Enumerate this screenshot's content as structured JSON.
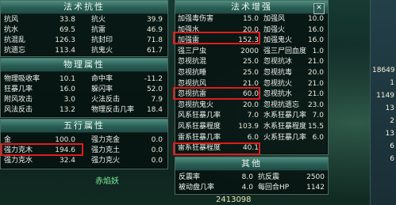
{
  "resist": {
    "title": "法术抗性",
    "rows": [
      {
        "l1": "抗风",
        "v1": "33.8",
        "l2": "抗火",
        "v2": "39.9"
      },
      {
        "l1": "抗水",
        "v1": "69.5",
        "l2": "抗雷",
        "v2": "46.9"
      },
      {
        "l1": "抗混乱",
        "v1": "126.3",
        "l2": "抗封印",
        "v2": "71.8"
      },
      {
        "l1": "抗遗忘",
        "v1": "113.4",
        "l2": "抗鬼火",
        "v2": "61.7"
      }
    ]
  },
  "physical": {
    "title": "物理属性",
    "rows": [
      {
        "l1": "物理吸收率",
        "v1": "10.1",
        "l2": "命中率",
        "v2": "-11.2"
      },
      {
        "l1": "狂暴几率",
        "v1": "16.0",
        "l2": "躲闪率",
        "v2": "52.0"
      },
      {
        "l1": "附风攻击",
        "v1": "3.0",
        "l2": "火法反击",
        "v2": "7.9"
      },
      {
        "l1": "风法反击",
        "v1": "13.2",
        "l2": "物理反击几率",
        "v2": "18.4"
      }
    ]
  },
  "five": {
    "title": "五行属性",
    "rows": [
      {
        "l1": "金",
        "v1": "100.0",
        "l2": "强力克金",
        "v2": "0.0"
      },
      {
        "l1": "强力克木",
        "v1": "194.6",
        "l2": "强力克土",
        "v2": "0.0"
      },
      {
        "l1": "强力克水",
        "v1": "32.4",
        "l2": "强力克火",
        "v2": "0.0"
      }
    ],
    "watermark": "赤焰妖"
  },
  "boost": {
    "title": "法术增强",
    "rows": [
      {
        "l1": "加强毒伤害",
        "v1": "15.0",
        "l2": "加强风",
        "v2": "10.0"
      },
      {
        "l1": "加强水",
        "v1": "20.0",
        "l2": "加强火",
        "v2": "16.0"
      },
      {
        "l1": "加强雷",
        "v1": "152.3",
        "l2": "加强鬼火",
        "v2": "16.0"
      },
      {
        "l1": "强三尸虫",
        "v1": "2000",
        "l2": "强三尸回血度",
        "v2": "1.0"
      },
      {
        "l1": "忽视抗混",
        "v1": "25.0",
        "l2": "忽视抗冰",
        "v2": "21.0"
      },
      {
        "l1": "忽视抗睡",
        "v1": "25.0",
        "l2": "忽视抗毒",
        "v2": "20.0"
      },
      {
        "l1": "忽视抗风",
        "v1": "21.0",
        "l2": "忽视抗火",
        "v2": "21.0"
      },
      {
        "l1": "忽视抗雷",
        "v1": "60.0",
        "l2": "忽视抗水",
        "v2": "21.0"
      },
      {
        "l1": "忽视抗鬼火",
        "v1": "20.0",
        "l2": "忽视抗遗忘",
        "v2": "23.0"
      },
      {
        "l1": "风系狂暴几率",
        "v1": "7.0",
        "l2": "水系狂暴几率",
        "v2": "7.0"
      },
      {
        "l1": "风系狂暴程度",
        "v1": "103.9",
        "l2": "水系狂暴程度",
        "v2": "15.5"
      },
      {
        "l1": "雷系狂暴几率",
        "v1": "6.0",
        "l2": "火系狂暴几率",
        "v2": "6.0"
      },
      {
        "l1": "雷系狂暴程度",
        "v1": "40.1",
        "l2": "",
        "v2": ""
      }
    ]
  },
  "other": {
    "title": "其他",
    "rows": [
      {
        "l1": "反震率",
        "v1": "8.0",
        "l2": "抗反震",
        "v2": "2500"
      },
      {
        "l1": "被动盘几率",
        "v1": "4.0",
        "l2": "每回合HP",
        "v2": "1142"
      }
    ]
  },
  "side": {
    "values": [
      "18649",
      "1",
      "1149",
      "13",
      "2",
      "13",
      "6",
      "6"
    ],
    "bottom_value": "2413098"
  },
  "colors": {
    "header": "#2a5e55",
    "panel": "#06120f",
    "highlight": "#e21b1b",
    "text": "#f0f4ee"
  }
}
